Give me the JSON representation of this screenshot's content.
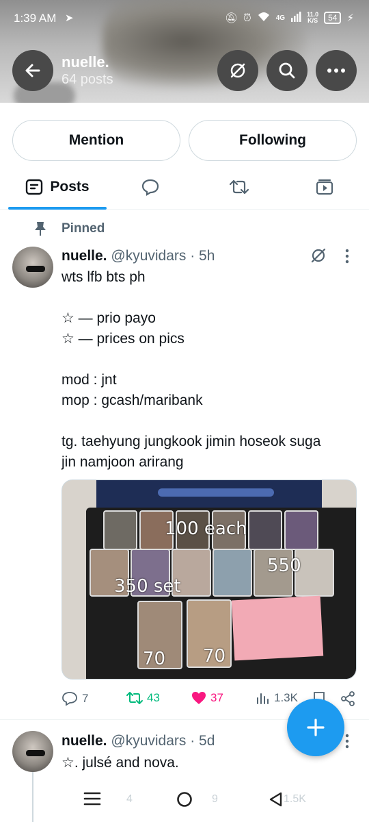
{
  "status_bar": {
    "time": "1:39 AM",
    "network_top": "4G",
    "speed_value": "11.0",
    "speed_unit": "K/S",
    "battery": "54"
  },
  "header": {
    "name": "nuelle.",
    "post_count": "64 posts"
  },
  "profile_actions": {
    "mention_label": "Mention",
    "following_label": "Following"
  },
  "tabs": {
    "posts_label": "Posts"
  },
  "pinned_label": "Pinned",
  "tweet1": {
    "name": "nuelle.",
    "handle_time": "@kyuvidars · 5h",
    "body": "wts lfb bts ph\n\n☆ — prio payo\n☆ — prices on pics\n\nmod : jnt\nmop : gcash/maribank\n\ntg. taehyung jungkook jimin hoseok suga\njin namjoon arirang",
    "photo_text": {
      "each": "100 each",
      "set": "350 set",
      "right": "550",
      "left_price": "70",
      "right_price": "70"
    },
    "replies": "7",
    "reposts": "43",
    "likes": "37",
    "views": "1.3K"
  },
  "tweet2": {
    "name": "nuelle.",
    "handle_time": "@kyuvidars · 5d",
    "body": "☆. julsé and nova.",
    "reposts": "4",
    "likes": "9",
    "views": "1.5K"
  },
  "colors": {
    "accent": "#1d9bf0",
    "repost_green": "#00ba7c",
    "like_pink": "#f91880",
    "muted": "#536471"
  }
}
